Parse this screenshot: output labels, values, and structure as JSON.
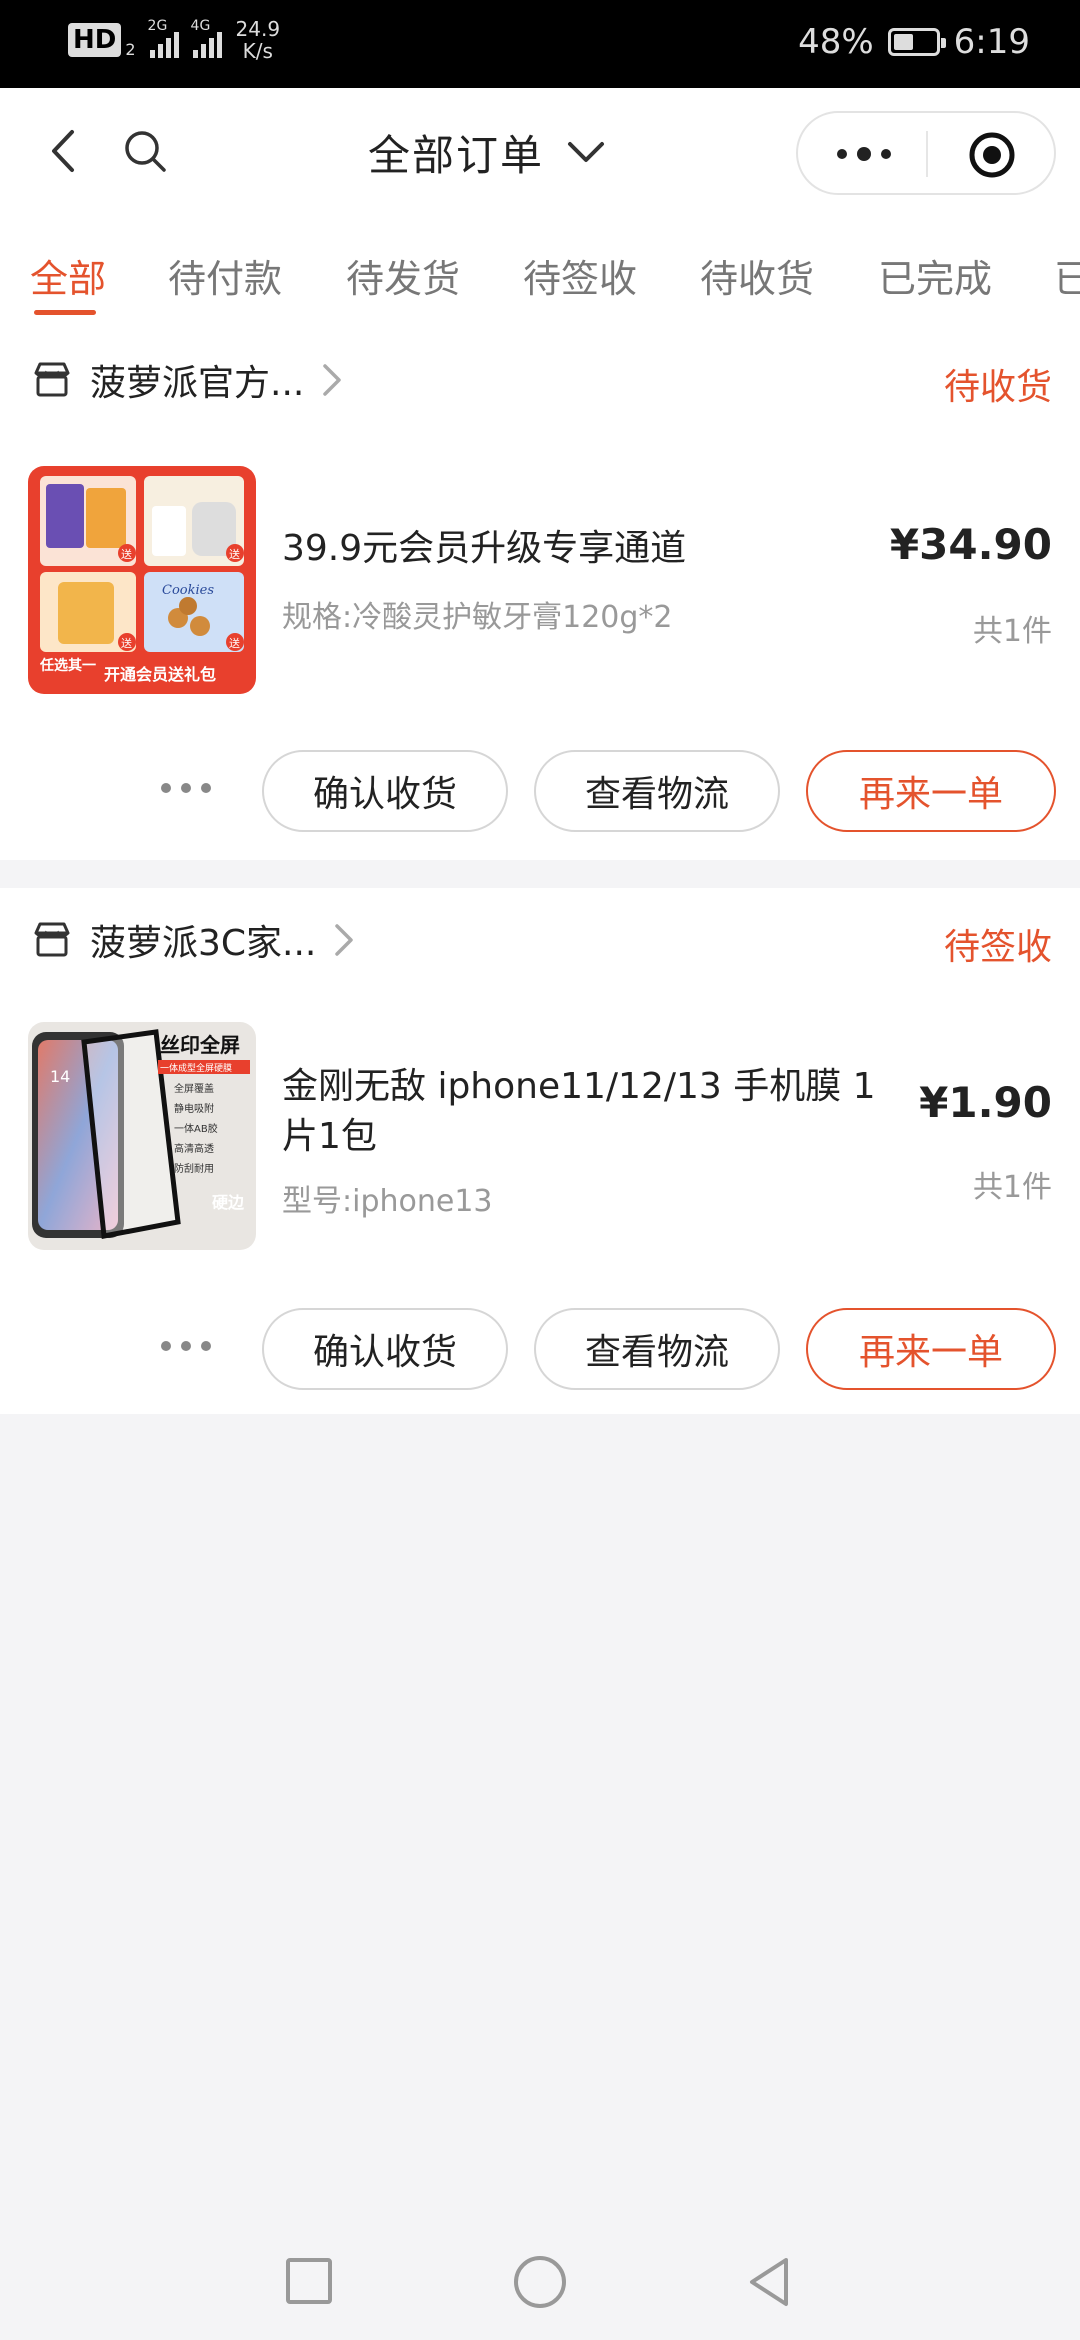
{
  "status_bar": {
    "network_badge": "HD",
    "network_badge_sub": "2",
    "signal1_label": "2G",
    "signal2_label": "4G",
    "speed_value": "24.9",
    "speed_unit": "K/s",
    "battery_percent": "48%",
    "battery_level": 0.48,
    "time": "6:19"
  },
  "header": {
    "title": "全部订单"
  },
  "tabs": [
    {
      "label": "全部",
      "active": true
    },
    {
      "label": "待付款"
    },
    {
      "label": "待发货"
    },
    {
      "label": "待签收"
    },
    {
      "label": "待收货"
    },
    {
      "label": "已完成"
    },
    {
      "label": "已"
    }
  ],
  "orders": [
    {
      "shop_name": "菠萝派官方...",
      "status": "待收货",
      "product_title": "39.9元会员升级专享通道",
      "product_spec": "规格:冷酸灵护敏牙膏120g*2",
      "price": "¥34.90",
      "quantity": "共1件",
      "thumb_text": {
        "pick": "任选其一",
        "banner": "开通会员送礼包",
        "give": "送",
        "cookies": "Cookies"
      },
      "actions": {
        "confirm": "确认收货",
        "logistics": "查看物流",
        "reorder": "再来一单"
      }
    },
    {
      "shop_name": "菠萝派3C家...",
      "status": "待签收",
      "product_title": "金刚无敌 iphone11/12/13 手机膜 1片1包",
      "product_spec": "型号:iphone13",
      "price": "¥1.90",
      "quantity": "共1件",
      "thumb_text": {
        "headline": "丝印全屏",
        "sub": "一体成型全屏硬膜",
        "features": [
          "全屏覆盖",
          "静电吸附",
          "一体AB胶",
          "高清高透",
          "防刮耐用"
        ],
        "edge": "硬边",
        "time": "14"
      },
      "actions": {
        "confirm": "确认收货",
        "logistics": "查看物流",
        "reorder": "再来一单"
      }
    }
  ],
  "colors": {
    "accent": "#e4532d",
    "background": "#f4f4f6",
    "status_bar": "#000000"
  }
}
